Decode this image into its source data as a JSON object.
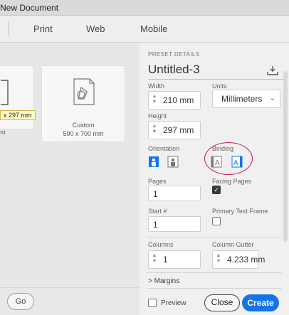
{
  "window": {
    "title": "New Document"
  },
  "tabs": [
    {
      "label": "Print"
    },
    {
      "label": "Web"
    },
    {
      "label": "Mobile"
    }
  ],
  "left": {
    "preset_cut_size": "x 297 mm",
    "preset_cut_label": "m",
    "custom_label": "Custom",
    "custom_size": "500 x 700 mm",
    "go_label": "Go"
  },
  "panel": {
    "section_title": "PRESET DETAILS",
    "doc_name": "Untitled-3",
    "width_label": "Width",
    "width_value": "210 mm",
    "units_label": "Units",
    "units_value": "Millimeters",
    "height_label": "Height",
    "height_value": "297 mm",
    "orientation_label": "Orientation",
    "binding_label": "Binding",
    "pages_label": "Pages",
    "pages_value": "1",
    "facing_label": "Facing Pages",
    "facing_checked": true,
    "start_label": "Start #",
    "start_value": "1",
    "ptf_label": "Primary Text Frame",
    "ptf_checked": false,
    "columns_label": "Columns",
    "columns_value": "1",
    "gutter_label": "Column Gutter",
    "gutter_value": "4.233 mm",
    "margins_label": "Margins",
    "preview_label": "Preview",
    "close_label": "Close",
    "create_label": "Create"
  },
  "colors": {
    "accent": "#1473e6",
    "highlight_ring": "#c2185b"
  }
}
